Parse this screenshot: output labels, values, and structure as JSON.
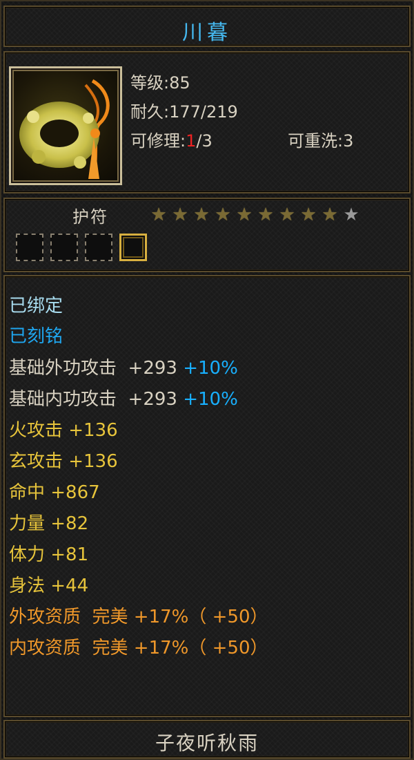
{
  "item": {
    "name": "川暮",
    "icon": "jade-ring-pendant-icon",
    "level_text": "等级:85",
    "durability_label": "耐久:",
    "durability_value": "177/219",
    "repair_label": "可修理:",
    "repair_used": "1",
    "repair_total": "/3",
    "reroll_label": "可重洗:",
    "reroll_value": "3",
    "type": "护符",
    "stars": {
      "lit": 9,
      "total": 10
    },
    "slots": [
      {
        "state": "empty"
      },
      {
        "state": "empty"
      },
      {
        "state": "empty"
      },
      {
        "state": "gold"
      }
    ]
  },
  "attributes": {
    "bound": "已绑定",
    "engraved": "已刻铭",
    "lines": [
      {
        "label": "基础外功攻击  +293",
        "bonus": " +10%",
        "style": "base"
      },
      {
        "label": "基础内功攻击  +293",
        "bonus": " +10%",
        "style": "base"
      },
      {
        "label": "火攻击 +136",
        "bonus": "",
        "style": "yellow"
      },
      {
        "label": "玄攻击 +136",
        "bonus": "",
        "style": "yellow"
      },
      {
        "label": "命中 +867",
        "bonus": "",
        "style": "yellow"
      },
      {
        "label": "力量 +82",
        "bonus": "",
        "style": "yellow"
      },
      {
        "label": "体力 +81",
        "bonus": "",
        "style": "yellow"
      },
      {
        "label": "身法 +44",
        "bonus": "",
        "style": "yellow"
      },
      {
        "label": "外攻资质  完美 +17%（ +50）",
        "bonus": "",
        "style": "orange"
      },
      {
        "label": "内攻资质  完美 +17%（ +50）",
        "bonus": "",
        "style": "orange"
      }
    ]
  },
  "footer": {
    "owner": "子夜听秋雨"
  },
  "colors": {
    "title": "#45b8ef",
    "base_text": "#d9d2c2",
    "repair_used": "#ee2222",
    "bonus_blue": "#18b0ff",
    "yellow": "#e7c43b",
    "orange": "#f0982a"
  }
}
